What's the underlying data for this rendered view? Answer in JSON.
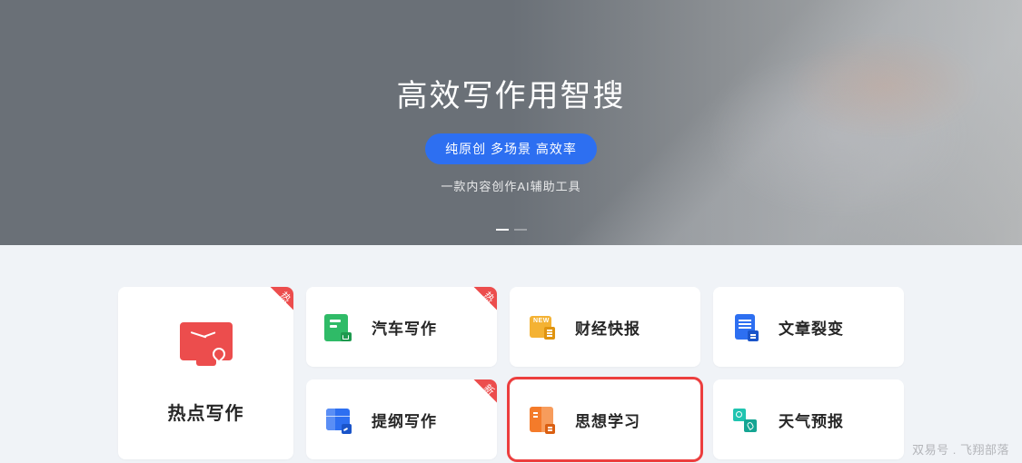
{
  "hero": {
    "title": "高效写作用智搜",
    "pill": "纯原创 多场景 高效率",
    "subtitle": "一款内容创作AI辅助工具"
  },
  "badges": {
    "hot": "热",
    "new": "新"
  },
  "featured": {
    "label": "热点写作",
    "badge": "hot",
    "icon": "hotspot"
  },
  "cards": [
    {
      "label": "汽车写作",
      "icon": "car",
      "badge": "hot",
      "highlighted": false
    },
    {
      "label": "财经快报",
      "icon": "finance",
      "badge": null,
      "highlighted": false
    },
    {
      "label": "文章裂变",
      "icon": "split",
      "badge": null,
      "highlighted": false
    },
    {
      "label": "提纲写作",
      "icon": "outline",
      "badge": "new",
      "highlighted": false
    },
    {
      "label": "思想学习",
      "icon": "thought",
      "badge": null,
      "highlighted": true
    },
    {
      "label": "天气预报",
      "icon": "weather",
      "badge": null,
      "highlighted": false
    }
  ],
  "watermark": "双易号 . 飞翔部落",
  "icons": {
    "finance_new_text": "NEW"
  }
}
